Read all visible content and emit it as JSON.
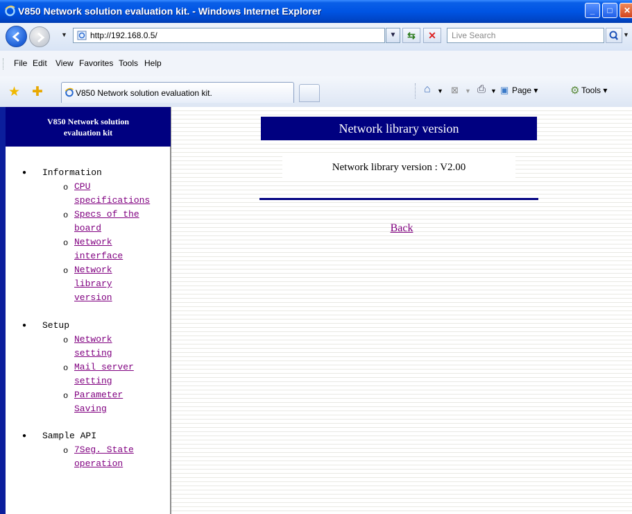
{
  "window": {
    "title": "V850 Network solution evaluation kit. - Windows Internet Explorer"
  },
  "address_bar": {
    "url": "http://192.168.0.5/",
    "search_placeholder": "Live Search"
  },
  "menu": [
    "File",
    "Edit",
    "View",
    "Favorites",
    "Tools",
    "Help"
  ],
  "tab": {
    "label": "V850 Network solution evaluation kit."
  },
  "command_bar": {
    "page": "Page ▾",
    "tools": "Tools ▾"
  },
  "sidebar": {
    "header_line1": "V850 Network solution",
    "header_line2": "evaluation kit",
    "sections": [
      {
        "label": "Information",
        "links": [
          [
            "CPU",
            "specifications"
          ],
          [
            "Specs of the",
            "board"
          ],
          [
            "Network",
            "interface"
          ],
          [
            "Network",
            "library",
            "version"
          ]
        ]
      },
      {
        "label": "Setup",
        "links": [
          [
            "Network",
            "setting"
          ],
          [
            "Mail server",
            "setting"
          ],
          [
            "Parameter",
            "Saving"
          ]
        ]
      },
      {
        "label": "Sample API",
        "links": [
          [
            "7Seg. State",
            "operation"
          ]
        ]
      }
    ]
  },
  "main": {
    "title": "Network library version",
    "version_text": "Network library version : V2.00",
    "back_link": "Back"
  },
  "colors": {
    "header_navy": "#000080",
    "visited_link": "#800080"
  }
}
